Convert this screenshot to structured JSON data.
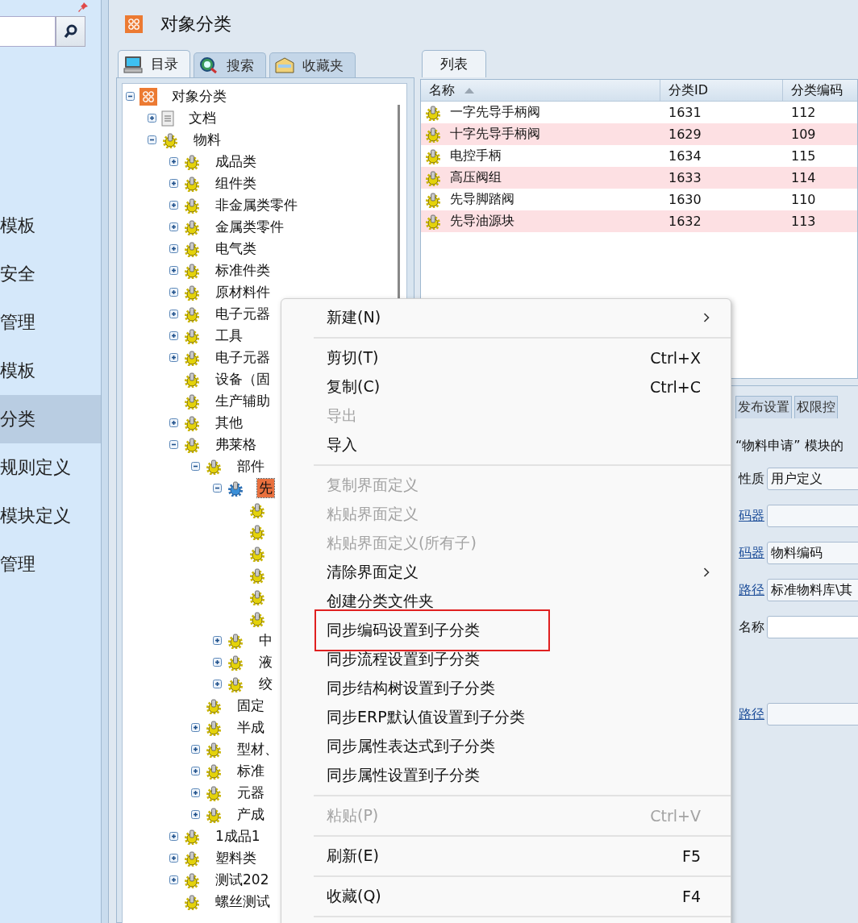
{
  "sidebar": {
    "items": [
      {
        "label": "模板",
        "selected": false
      },
      {
        "label": "安全",
        "selected": false
      },
      {
        "label": "管理",
        "selected": false
      },
      {
        "label": "模板",
        "selected": false
      },
      {
        "label": "分类",
        "selected": true
      },
      {
        "label": "规则定义",
        "selected": false
      },
      {
        "label": "模块定义",
        "selected": false
      },
      {
        "label": "管理",
        "selected": false
      }
    ]
  },
  "header": {
    "title": "对象分类"
  },
  "left_tabs": [
    {
      "label": "目录",
      "kind": "catalog",
      "selected": true
    },
    {
      "label": "搜索",
      "kind": "search",
      "selected": false
    },
    {
      "label": "收藏夹",
      "kind": "favorites",
      "selected": false
    }
  ],
  "tree": {
    "label": "对象分类",
    "kind": "root",
    "expanded": true,
    "selected": false,
    "children": [
      {
        "label": "文档",
        "kind": "document",
        "expanded": false,
        "selected": false
      },
      {
        "label": "物料",
        "kind": "category",
        "expanded": true,
        "selected": false,
        "children": [
          {
            "label": "成品类",
            "kind": "category",
            "expanded": false,
            "selected": false
          },
          {
            "label": "组件类",
            "kind": "category",
            "expanded": false,
            "selected": false
          },
          {
            "label": "非金属类零件",
            "kind": "category",
            "expanded": false,
            "selected": false
          },
          {
            "label": "金属类零件",
            "kind": "category",
            "expanded": false,
            "selected": false
          },
          {
            "label": "电气类",
            "kind": "category",
            "expanded": false,
            "selected": false
          },
          {
            "label": "标准件类",
            "kind": "category",
            "expanded": false,
            "selected": false
          },
          {
            "label": "原材料件",
            "kind": "category",
            "expanded": false,
            "selected": false
          },
          {
            "label": "电子元器",
            "kind": "category",
            "expanded": false,
            "selected": false
          },
          {
            "label": "工具",
            "kind": "category",
            "expanded": false,
            "selected": false
          },
          {
            "label": "电子元器",
            "kind": "category",
            "expanded": false,
            "selected": false
          },
          {
            "label": "设备（固",
            "kind": "category",
            "selected": false
          },
          {
            "label": "生产辅助",
            "kind": "category",
            "selected": false
          },
          {
            "label": "其他",
            "kind": "category",
            "expanded": false,
            "selected": false
          },
          {
            "label": "弗莱格",
            "kind": "category",
            "expanded": true,
            "selected": false,
            "children": [
              {
                "label": "部件",
                "kind": "category",
                "expanded": true,
                "selected": false,
                "children": [
                  {
                    "label": "先",
                    "kind": "category",
                    "expanded": true,
                    "selected": true,
                    "children": [
                      {
                        "kind": "category",
                        "selected": false
                      },
                      {
                        "kind": "category",
                        "selected": false
                      },
                      {
                        "kind": "category",
                        "selected": false
                      },
                      {
                        "kind": "category",
                        "selected": false
                      },
                      {
                        "kind": "category",
                        "selected": false
                      },
                      {
                        "kind": "category",
                        "selected": false
                      }
                    ]
                  },
                  {
                    "label": "中",
                    "kind": "category",
                    "expanded": false,
                    "selected": false
                  },
                  {
                    "label": "液",
                    "kind": "category",
                    "expanded": false,
                    "selected": false
                  },
                  {
                    "label": "绞",
                    "kind": "category",
                    "expanded": false,
                    "selected": false
                  }
                ]
              },
              {
                "label": "固定",
                "kind": "category",
                "selected": false
              },
              {
                "label": "半成",
                "kind": "category",
                "expanded": false,
                "selected": false
              },
              {
                "label": "型材、",
                "kind": "category",
                "expanded": false,
                "selected": false
              },
              {
                "label": "标准",
                "kind": "category",
                "expanded": false,
                "selected": false
              },
              {
                "label": "元器",
                "kind": "category",
                "expanded": false,
                "selected": false
              },
              {
                "label": "产成",
                "kind": "category",
                "expanded": false,
                "selected": false
              }
            ]
          },
          {
            "label": "1成品1",
            "kind": "category",
            "expanded": false,
            "selected": false
          },
          {
            "label": "塑料类",
            "kind": "category",
            "expanded": false,
            "selected": false
          },
          {
            "label": "测试202",
            "kind": "category",
            "expanded": false,
            "selected": false
          },
          {
            "label": "螺丝测试",
            "kind": "category",
            "selected": false
          }
        ]
      }
    ]
  },
  "right_tabs": [
    {
      "label": "列表",
      "selected": true
    }
  ],
  "table": {
    "columns": [
      {
        "label": "名称",
        "sorted": true
      },
      {
        "label": "分类ID"
      },
      {
        "label": "分类编码"
      }
    ],
    "rows": [
      [
        "一字先导手柄阀",
        "1631",
        "112"
      ],
      [
        "十字先导手柄阀",
        "1629",
        "109"
      ],
      [
        "电控手柄",
        "1634",
        "115"
      ],
      [
        "高压阀组",
        "1633",
        "114"
      ],
      [
        "先导脚踏阀",
        "1630",
        "110"
      ],
      [
        "先导油源块",
        "1632",
        "113"
      ]
    ]
  },
  "detail": {
    "tabs": [
      {
        "label": "发布设置",
        "selected": false
      },
      {
        "label": "权限控",
        "selected": false
      }
    ],
    "caption": "“物料申请” 模块的",
    "fields": [
      {
        "label": "性质",
        "kind": "text",
        "value": "用户定义"
      },
      {
        "label": "码器",
        "kind": "link"
      },
      {
        "label": "码器",
        "kind": "link",
        "value": "物料编码"
      },
      {
        "label": "路径",
        "kind": "link",
        "value": "标准物料库\\其"
      },
      {
        "label": "名称",
        "kind": "text"
      },
      {
        "label": "路径",
        "kind": "link"
      }
    ]
  },
  "context_menu": [
    {
      "kind": "item",
      "label": "新建(N)",
      "disabled": false,
      "submenu": true
    },
    {
      "kind": "separator"
    },
    {
      "kind": "item",
      "label": "剪切(T)",
      "shortcut": "Ctrl+X",
      "disabled": false
    },
    {
      "kind": "item",
      "label": "复制(C)",
      "shortcut": "Ctrl+C",
      "disabled": false
    },
    {
      "kind": "item",
      "label": "导出",
      "disabled": true
    },
    {
      "kind": "item",
      "label": "导入",
      "disabled": false
    },
    {
      "kind": "separator"
    },
    {
      "kind": "item",
      "label": "复制界面定义",
      "disabled": true
    },
    {
      "kind": "item",
      "label": "粘贴界面定义",
      "disabled": true
    },
    {
      "kind": "item",
      "label": "粘贴界面定义(所有子)",
      "disabled": true
    },
    {
      "kind": "item",
      "label": "清除界面定义",
      "disabled": false,
      "submenu": true
    },
    {
      "kind": "item",
      "label": "创建分类文件夹",
      "disabled": false
    },
    {
      "kind": "item",
      "label": "同步编码设置到子分类",
      "disabled": false,
      "highlighted": true
    },
    {
      "kind": "item",
      "label": "同步流程设置到子分类",
      "disabled": false
    },
    {
      "kind": "item",
      "label": "同步结构树设置到子分类",
      "disabled": false
    },
    {
      "kind": "item",
      "label": "同步ERP默认值设置到子分类",
      "disabled": false
    },
    {
      "kind": "item",
      "label": "同步属性表达式到子分类",
      "disabled": false
    },
    {
      "kind": "item",
      "label": "同步属性设置到子分类",
      "disabled": false
    },
    {
      "kind": "separator"
    },
    {
      "kind": "item",
      "label": "粘贴(P)",
      "shortcut": "Ctrl+V",
      "disabled": true
    },
    {
      "kind": "separator"
    },
    {
      "kind": "item",
      "label": "刷新(E)",
      "shortcut": "F5",
      "disabled": false
    },
    {
      "kind": "separator"
    },
    {
      "kind": "item",
      "label": "收藏(Q)",
      "shortcut": "F4",
      "disabled": false
    },
    {
      "kind": "separator"
    }
  ]
}
